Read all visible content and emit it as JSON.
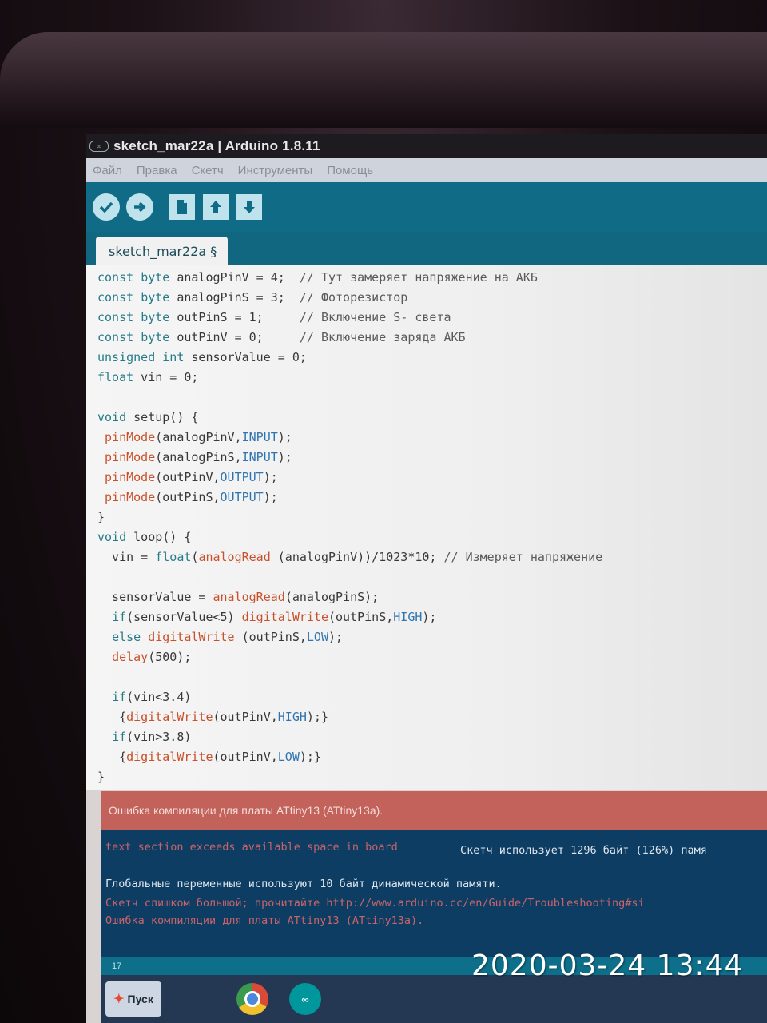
{
  "window": {
    "title": "sketch_mar22a | Arduino 1.8.11"
  },
  "menu": [
    "Файл",
    "Правка",
    "Скетч",
    "Инструменты",
    "Помощь"
  ],
  "toolbar": {
    "verify_icon": "check-icon",
    "upload_icon": "arrow-right-icon",
    "new_icon": "file-icon",
    "open_icon": "arrow-up-icon",
    "save_icon": "arrow-down-icon"
  },
  "tab": {
    "label": "sketch_mar22a §"
  },
  "code": [
    "const byte analogPinV = 4;  // Тут замеряет напряжение на АКБ",
    "const byte analogPinS = 3;  // Фоторезистор",
    "const byte outPinS = 1;     // Включение S- света",
    "const byte outPinV = 0;     // Включение заряда АКБ",
    "unsigned int sensorValue = 0;",
    "float vin = 0;",
    "",
    "void setup() {",
    " pinMode(analogPinV,INPUT);",
    " pinMode(analogPinS,INPUT);",
    " pinMode(outPinV,OUTPUT);",
    " pinMode(outPinS,OUTPUT);",
    "}",
    "void loop() {",
    "  vin = float(analogRead (analogPinV))/1023*10; // Измеряет напряжение",
    "",
    "  sensorValue = analogRead(analogPinS);",
    "  if(sensorValue<5) digitalWrite(outPinS,HIGH);",
    "  else digitalWrite (outPinS,LOW);",
    "  delay(500);",
    "",
    "  if(vin<3.4)",
    "   {digitalWrite(outPinV,HIGH);}",
    "  if(vin>3.8)",
    "   {digitalWrite(outPinV,LOW);}",
    "}"
  ],
  "error_bar": {
    "message": "Ошибка компиляции для платы ATtiny13 (ATtiny13a)."
  },
  "console": [
    {
      "text": "text section exceeds available space in board",
      "color": "red"
    },
    {
      "text": "Скетч использует 1296 байт (126%) памя",
      "color": "white"
    },
    {
      "text": "Глобальные переменные используют 10 байт динамической памяти.",
      "color": "white"
    },
    {
      "text": "Скетч слишком большой; прочитайте http://www.arduino.cc/en/Guide/Troubleshooting#si",
      "color": "red"
    },
    {
      "text": "Ошибка компиляции для платы ATtiny13 (ATtiny13a).",
      "color": "red"
    }
  ],
  "status": {
    "line_number": "17"
  },
  "taskbar": {
    "start_label": "Пуск",
    "apps": [
      "chrome-icon",
      "arduino-icon"
    ]
  },
  "photo": {
    "timestamp": "2020-03-24  13:44"
  },
  "colors": {
    "toolbar": "#0f6b86",
    "error_bar": "#c3625a",
    "console_bg": "#0d3d63"
  }
}
